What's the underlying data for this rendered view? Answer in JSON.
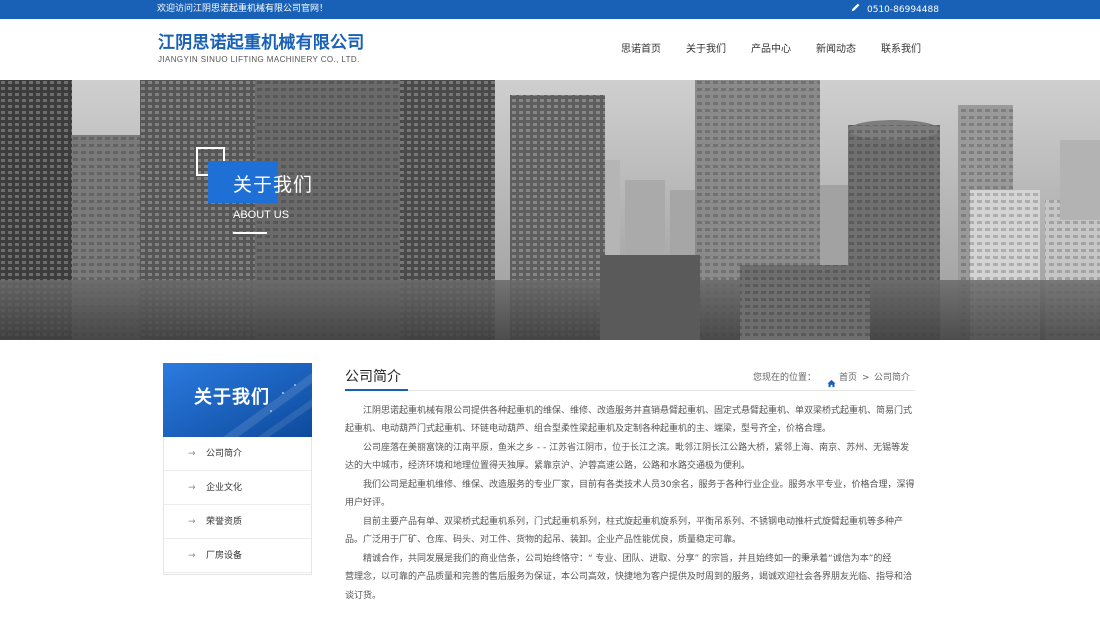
{
  "topbar": {
    "welcome": "欢迎访问江阴思诺起重机械有限公司官网！",
    "phone_icon": "pencil-icon",
    "phone": "0510-86994488"
  },
  "header": {
    "logo_cn": "江阴思诺起重机械有限公司",
    "logo_en": "JIANGYIN SINUO LIFTING MACHINERY CO., LTD.",
    "nav": [
      "思诺首页",
      "关于我们",
      "产品中心",
      "新闻动态",
      "联系我们"
    ]
  },
  "banner": {
    "title": "关于我们",
    "subtitle": "ABOUT US"
  },
  "sidebar": {
    "title": "关于我们",
    "arrow_icon": "arrow-right-icon",
    "items": [
      "公司简介",
      "企业文化",
      "荣誉资质",
      "厂房设备"
    ]
  },
  "content": {
    "title": "公司简介",
    "breadcrumb": {
      "prefix": "您现在的位置：",
      "home_icon": "home-icon",
      "home": "首页",
      "separator": ">",
      "current": "公司简介"
    },
    "lines": [
      "江阴思诺起重机械有限公司提供各种起重机的维保、维修、改造服务并直销悬臂起重机、固定式悬臂起重机、单双梁桥式起重机、简易门式",
      "起重机、电动葫芦门式起重机、环链电动葫芦、组合型柔性梁起重机及定制各种起重机的主、端梁，型号齐全，价格合理。",
      "公司座落在美丽富饶的江南平原，鱼米之乡 - - 江苏省江阴市，位于长江之滨。毗邻江阴长江公路大桥，紧邻上海、南京、苏州、无锡等发",
      "达的大中城市，经济环境和地理位置得天独厚。紧靠京沪、沪蓉高速公路，公路和水路交通极为便利。",
      "我们公司是起重机维修、维保、改造服务的专业厂家，目前有各类技术人员30余名，服务于各种行业企业。服务水平专业，价格合理，深得",
      "用户好评。",
      "目前主要产品有单、双梁桥式起重机系列，门式起重机系列，柱式旋起重机旋系列，平衡吊系列、不锈钢电动推杆式旋臂起重机等多种产",
      "品。广泛用于厂矿、仓库、码头、对工件、货物的起吊、装卸。企业产品性能优良，质量稳定可靠。",
      "精诚合作，共同发展是我们的商业信条，公司始终恪守：“ 专业、团队、进取、分享” 的宗旨，并且始终如一的秉承着“诚信为本”的经",
      "营理念，以可靠的产品质量和完善的售后服务为保证，本公司高效，快捷地为客户提供及时周到的服务，竭诚欢迎社会各界朋友光临、指导和洽",
      "谈订货。"
    ]
  },
  "colors": {
    "brand_blue": "#1861b6",
    "accent_blue": "#1e6fd6"
  }
}
